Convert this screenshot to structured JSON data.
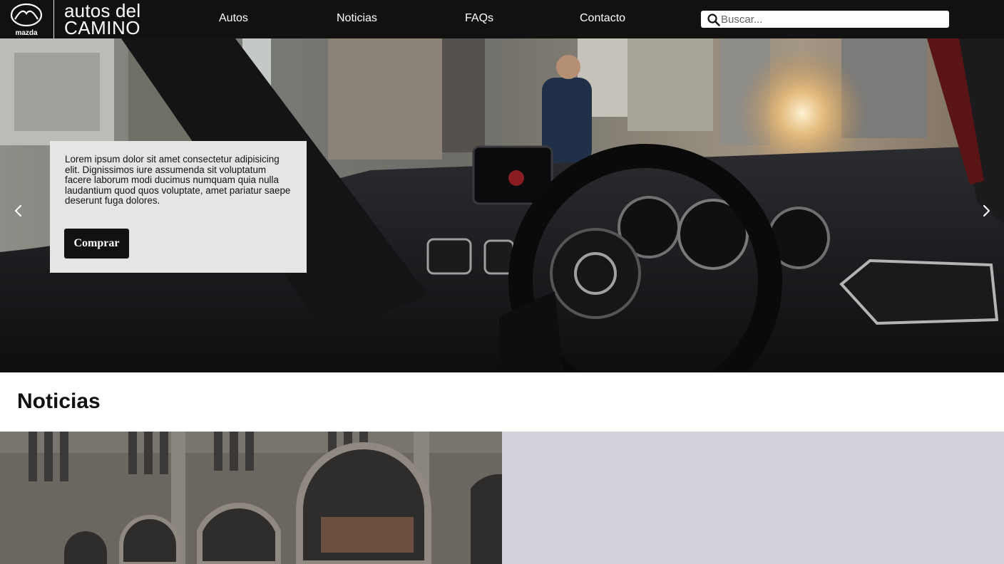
{
  "brand": {
    "emblem_label": "mazda",
    "line1": "autos del",
    "line2": "CAMINO"
  },
  "nav": {
    "items": [
      {
        "label": "Autos"
      },
      {
        "label": "Noticias"
      },
      {
        "label": "FAQs"
      },
      {
        "label": "Contacto"
      }
    ],
    "search": {
      "placeholder": "Buscar...",
      "value": "",
      "icon": "search-icon"
    }
  },
  "hero": {
    "caption": "Lorem ipsum dolor sit amet consectetur adipisicing elit. Dignissimos iure assumenda sit voluptatum facere laborum modi ducimus numquam quia nulla laudantium quod quos voluptate, amet pariatur saepe deserunt fuga dolores.",
    "button_label": "Comprar",
    "prev_icon": "chevron-left-icon",
    "next_icon": "chevron-right-icon"
  },
  "news": {
    "title": "Noticias"
  },
  "colors": {
    "navbar": "#111111",
    "caption_bg": "#e5e5e5",
    "button_bg": "#111111",
    "news_panel": "#d2d3da"
  }
}
